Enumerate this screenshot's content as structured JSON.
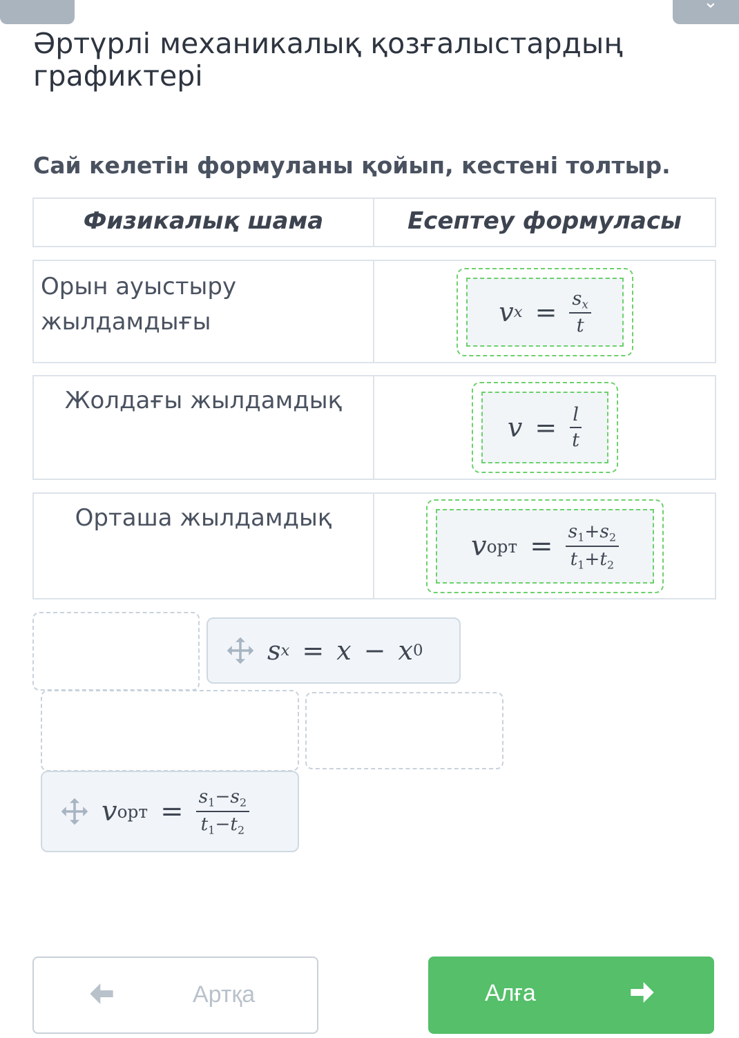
{
  "page": {
    "title": "Әртүрлі механикалық қозғалыстардың графиктері",
    "instruction": "Сай келетін формуланы қойып, кестені толтыр."
  },
  "table": {
    "headers": [
      "Физикалық шама",
      "Есептеу формуласы"
    ],
    "rows": [
      {
        "name": "Орын ауыстыру жылдамдығы",
        "formula": "v_x = s_x / t"
      },
      {
        "name": "Жолдағы жылдамдық",
        "formula": "v = l / t"
      },
      {
        "name": "Орташа жылдамдық",
        "formula": "v_орт = (s_1 + s_2) / (t_1 + t_2)"
      }
    ]
  },
  "formulas": {
    "vx": {
      "lhs": "v",
      "lhs_sub": "x",
      "eq": "=",
      "num": "s",
      "num_sub": "x",
      "den": "t"
    },
    "v": {
      "lhs": "v",
      "eq": "=",
      "num": "l",
      "den": "t"
    },
    "vavg": {
      "lhs": "v",
      "lhs_sub": "орт",
      "eq": "=",
      "num_a": "s",
      "num_a_sub": "1",
      "num_op": "+",
      "num_b": "s",
      "num_b_sub": "2",
      "den_a": "t",
      "den_a_sub": "1",
      "den_op": "+",
      "den_b": "t",
      "den_b_sub": "2"
    }
  },
  "bank": {
    "cards": [
      {
        "formula": "s_x = x − x_0",
        "lhs": "s",
        "lhs_sub": "x",
        "eq": "=",
        "a": "x",
        "op": "−",
        "b": "x",
        "b_sub": "0"
      },
      {
        "formula": "v_орт = (s_1 − s_2) / (t_1 − t_2)",
        "lhs": "v",
        "lhs_sub": "орт",
        "eq": "=",
        "num_a": "s",
        "num_a_sub": "1",
        "num_op": "−",
        "num_b": "s",
        "num_b_sub": "2",
        "den_a": "t",
        "den_a_sub": "1",
        "den_op": "−",
        "den_b": "t",
        "den_b_sub": "2"
      }
    ]
  },
  "buttons": {
    "back": "Артқа",
    "next": "Алға"
  },
  "colors": {
    "accent_green": "#55bf6a",
    "drop_border": "#6cd06c",
    "card_bg": "#f1f5f9"
  },
  "icons": {
    "move": "move-icon",
    "back_arrow": "arrow-left-icon",
    "next_arrow": "arrow-right-icon"
  }
}
